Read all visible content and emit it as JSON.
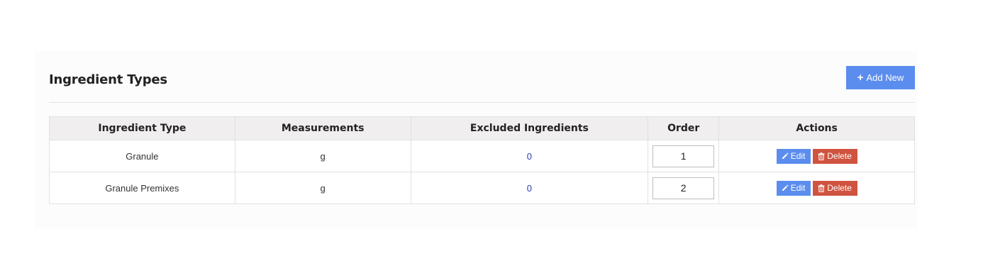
{
  "header": {
    "title": "Ingredient Types",
    "add_button_label": "Add New"
  },
  "table": {
    "columns": [
      "Ingredient Type",
      "Measurements",
      "Excluded Ingredients",
      "Order",
      "Actions"
    ],
    "rows": [
      {
        "ingredient_type": "Granule",
        "measurement": "g",
        "excluded": "0",
        "order": "1"
      },
      {
        "ingredient_type": "Granule Premixes",
        "measurement": "g",
        "excluded": "0",
        "order": "2"
      }
    ],
    "edit_label": "Edit",
    "delete_label": "Delete"
  },
  "colors": {
    "primary": "#5b8def",
    "danger": "#d0533f",
    "link": "#2b3db8"
  },
  "icons": {
    "add": "plus-icon",
    "edit": "pencil-icon",
    "delete": "trash-icon"
  }
}
